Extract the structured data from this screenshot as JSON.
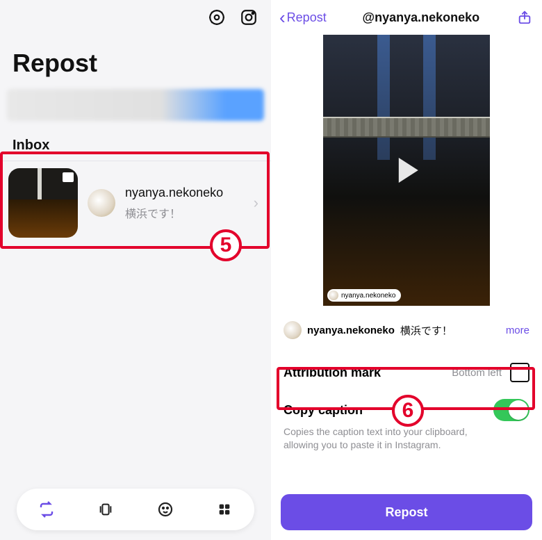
{
  "left": {
    "title": "Repost",
    "section_label": "Inbox",
    "inbox": {
      "username": "nyanya.nekoneko",
      "caption": "横浜です！"
    },
    "callout_number": "5"
  },
  "right": {
    "back_label": "Repost",
    "title": "@nyanya.nekoneko",
    "attrib_chip": "nyanya.nekoneko",
    "caption": {
      "username": "nyanya.nekoneko",
      "text": "横浜です！",
      "more": "more"
    },
    "attribution": {
      "title": "Attribution mark",
      "value": "Bottom left"
    },
    "copy": {
      "title": "Copy caption",
      "desc": "Copies the caption text into your clipboard, allowing you to paste it in Instagram."
    },
    "cta": "Repost",
    "callout_number": "6"
  }
}
